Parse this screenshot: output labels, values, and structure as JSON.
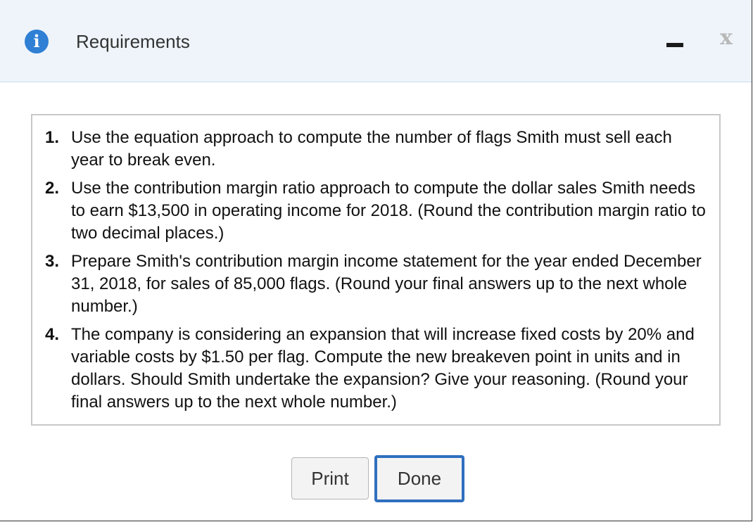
{
  "header": {
    "title": "Requirements",
    "info_icon": "i"
  },
  "window_controls": {
    "minimize": "minimize-icon",
    "close": "x"
  },
  "requirements": [
    {
      "num": "1.",
      "text": "Use the equation approach to compute the number of flags Smith must sell each year to break even."
    },
    {
      "num": "2.",
      "text": "Use the contribution margin ratio approach to compute the dollar sales Smith needs to earn $13,500 in operating income for 2018. (Round the contribution margin ratio to two decimal places.)"
    },
    {
      "num": "3.",
      "text": "Prepare Smith's contribution margin income statement for the year ended December 31, 2018, for sales of 85,000 flags. (Round your final answers up to the next whole number.)"
    },
    {
      "num": "4.",
      "text": "The company is considering an expansion that will increase fixed costs by 20% and variable costs by $1.50 per flag. Compute the new breakeven point in units and in dollars. Should Smith undertake the expansion? Give your reasoning. (Round your final answers up to the next whole number.)"
    }
  ],
  "buttons": {
    "print": "Print",
    "done": "Done"
  },
  "colors": {
    "header_bg": "#eef4fa",
    "info_icon": "#2f7fd5",
    "done_border": "#2f6fbf"
  }
}
